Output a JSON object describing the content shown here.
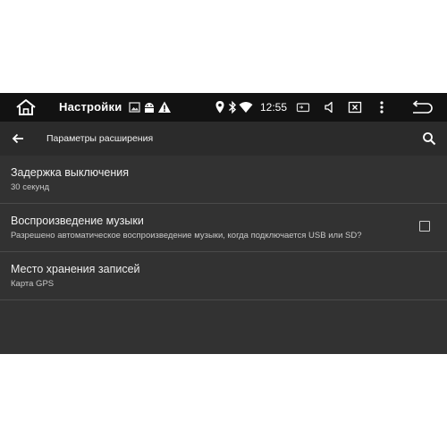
{
  "statusbar": {
    "title": "Настройки",
    "clock": "12:55",
    "icons": [
      "home-icon",
      "image-notification-icon",
      "android-notification-icon",
      "warning-icon",
      "location-icon",
      "bluetooth-icon",
      "wifi-icon",
      "screen-mirror-icon",
      "volume-icon",
      "close-window-icon",
      "more-vert-icon",
      "back-nav-icon"
    ]
  },
  "toolbar": {
    "title": "Параметры расширения",
    "icons": [
      "arrow-back-icon",
      "search-icon"
    ]
  },
  "preferences": [
    {
      "title": "Задержка выключения",
      "summary": "30 секунд"
    },
    {
      "title": "Воспроизведение музыки",
      "summary": "Разрешено автоматическое воспроизведение музыки, когда подключается USB или SD?",
      "checked": false
    },
    {
      "title": "Место хранения записей",
      "summary": "Карта GPS"
    }
  ],
  "colors": {
    "background": "#323232",
    "statusbar": "#121212",
    "toolbar": "#2b2b2b",
    "divider": "#4a4a4a",
    "text_primary": "#f0f0f0",
    "text_secondary": "#c8c8c8"
  }
}
